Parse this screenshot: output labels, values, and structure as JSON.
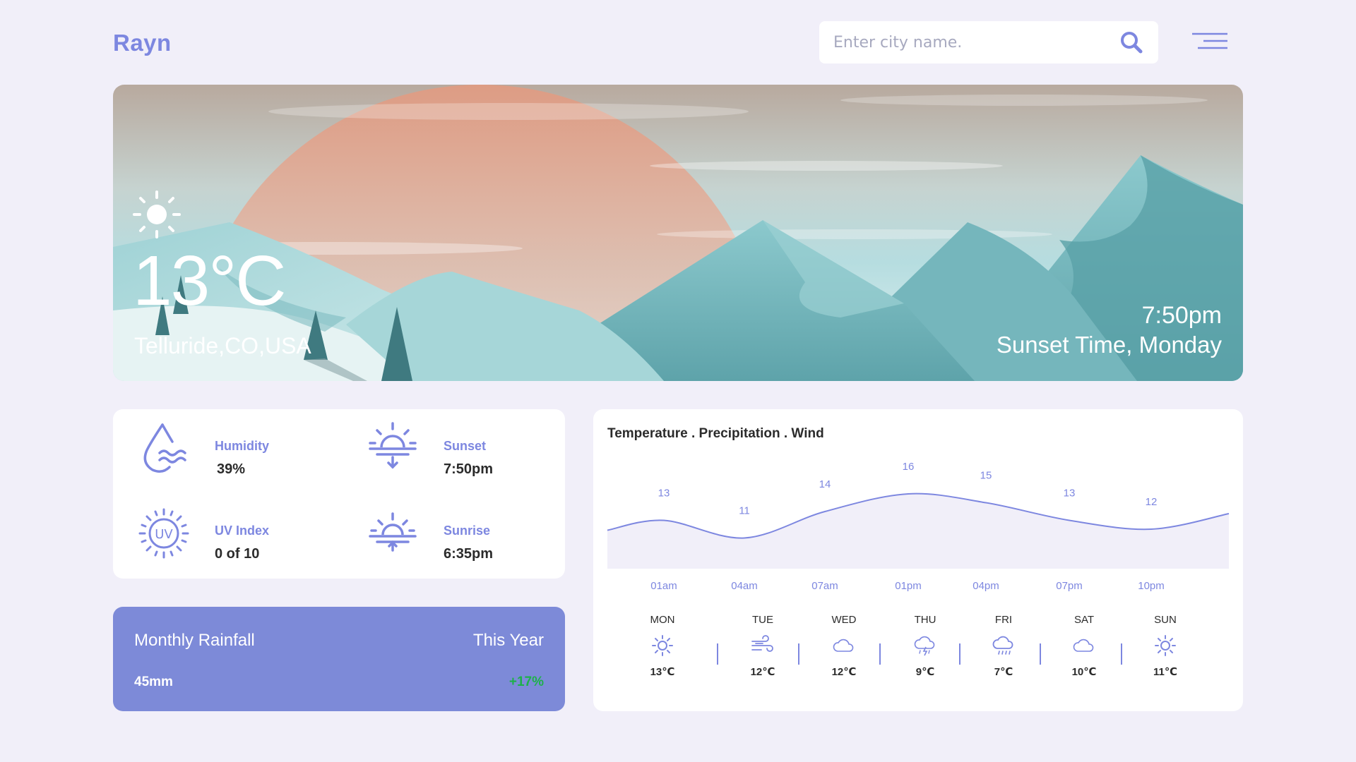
{
  "app": {
    "logo": "Rayn"
  },
  "search": {
    "placeholder": "Enter city name."
  },
  "hero": {
    "temperature": "13°C",
    "location": "Telluride,CO,USA",
    "time": "7:50pm",
    "time_label": "Sunset Time, Monday"
  },
  "stats": [
    {
      "icon": "humidity-icon",
      "label": "Humidity",
      "value": "39%"
    },
    {
      "icon": "sunset-icon",
      "label": "Sunset",
      "value": "7:50pm"
    },
    {
      "icon": "uv-index-icon",
      "label": "UV Index",
      "value": "0 of 10"
    },
    {
      "icon": "sunrise-icon",
      "label": "Sunrise",
      "value": "6:35pm"
    }
  ],
  "rainfall": {
    "title": "Monthly Rainfall",
    "period": "This Year",
    "amount": "45mm",
    "change": "+17%"
  },
  "forecast": {
    "title": "Temperature . Precipitation . Wind",
    "colors": {
      "accent": "#7d87e0",
      "fill": "#f1eff9"
    },
    "days": [
      {
        "name": "MON",
        "icon": "sun-icon",
        "temp": "13℃"
      },
      {
        "name": "TUE",
        "icon": "wind-icon",
        "temp": "12℃"
      },
      {
        "name": "WED",
        "icon": "cloud-icon",
        "temp": "12℃"
      },
      {
        "name": "THU",
        "icon": "thunderstorm-icon",
        "temp": "9℃"
      },
      {
        "name": "FRI",
        "icon": "rain-icon",
        "temp": "7℃"
      },
      {
        "name": "SAT",
        "icon": "cloud-icon",
        "temp": "10℃"
      },
      {
        "name": "SUN",
        "icon": "sun-icon",
        "temp": "11℃"
      }
    ]
  },
  "chart_data": {
    "type": "line",
    "categories": [
      "01am",
      "04am",
      "07am",
      "01pm",
      "04pm",
      "07pm",
      "10pm"
    ],
    "series": [
      {
        "values": [
          13,
          11,
          14,
          16,
          15,
          13,
          12
        ]
      }
    ],
    "title": "Temperature . Precipitation . Wind",
    "xlabel": "",
    "ylabel": "",
    "grid": false
  }
}
